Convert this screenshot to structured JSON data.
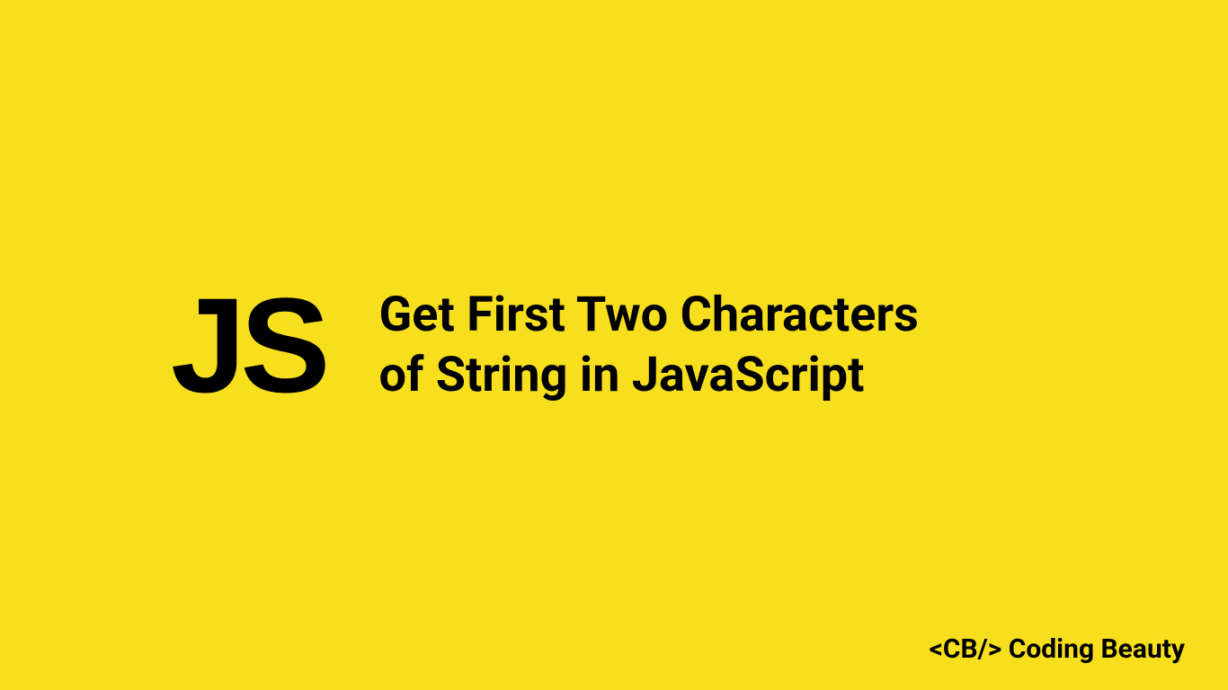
{
  "badge": "JS",
  "title_line1": "Get First Two Characters",
  "title_line2": "of String in JavaScript",
  "branding": "<CB/> Coding Beauty"
}
